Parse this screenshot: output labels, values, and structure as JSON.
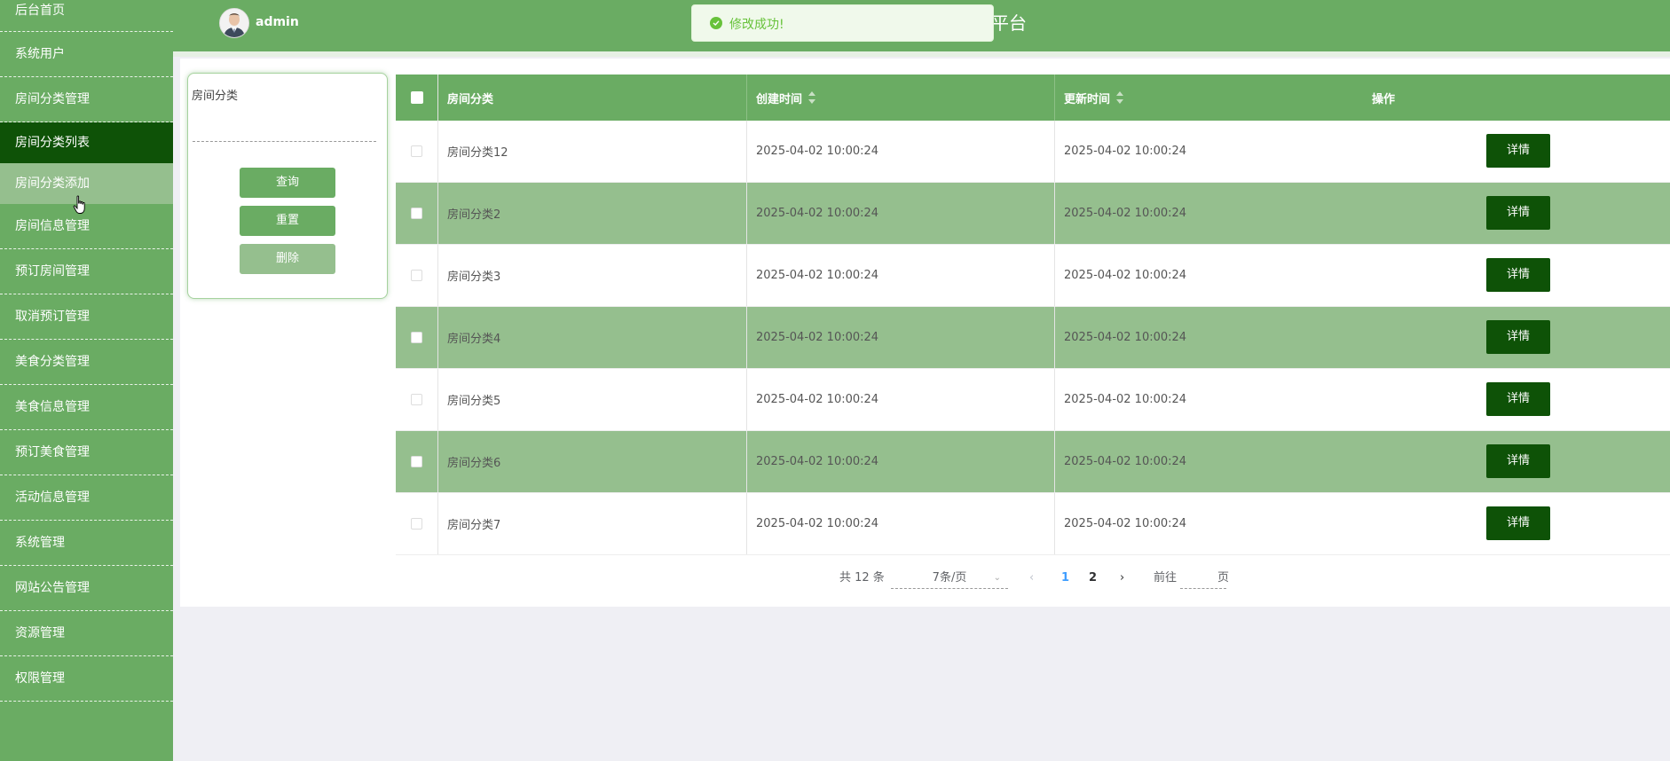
{
  "sidebar": {
    "items": [
      {
        "label": "后台首页",
        "state": "normal"
      },
      {
        "label": "系统用户",
        "state": "normal"
      },
      {
        "label": "房间分类管理",
        "state": "normal"
      },
      {
        "label": "房间分类列表",
        "state": "active"
      },
      {
        "label": "房间分类添加",
        "state": "hover"
      },
      {
        "label": "房间信息管理",
        "state": "normal"
      },
      {
        "label": "预订房间管理",
        "state": "normal"
      },
      {
        "label": "取消预订管理",
        "state": "normal"
      },
      {
        "label": "美食分类管理",
        "state": "normal"
      },
      {
        "label": "美食信息管理",
        "state": "normal"
      },
      {
        "label": "预订美食管理",
        "state": "normal"
      },
      {
        "label": "活动信息管理",
        "state": "normal"
      },
      {
        "label": "系统管理",
        "state": "normal"
      },
      {
        "label": "网站公告管理",
        "state": "normal"
      },
      {
        "label": "资源管理",
        "state": "normal"
      },
      {
        "label": "权限管理",
        "state": "normal"
      }
    ]
  },
  "header": {
    "username": "admin",
    "title_fragment": "平台",
    "toast": "修改成功!"
  },
  "search": {
    "label": "房间分类",
    "value": "",
    "query_button": "查询",
    "reset_button": "重置",
    "delete_button": "删除"
  },
  "table": {
    "headers": {
      "name": "房间分类",
      "created": "创建时间",
      "updated": "更新时间",
      "actions": "操作"
    },
    "detail_label": "详情",
    "rows": [
      {
        "name": "房间分类12",
        "created": "2025-04-02 10:00:24",
        "updated": "2025-04-02 10:00:24"
      },
      {
        "name": "房间分类2",
        "created": "2025-04-02 10:00:24",
        "updated": "2025-04-02 10:00:24"
      },
      {
        "name": "房间分类3",
        "created": "2025-04-02 10:00:24",
        "updated": "2025-04-02 10:00:24"
      },
      {
        "name": "房间分类4",
        "created": "2025-04-02 10:00:24",
        "updated": "2025-04-02 10:00:24"
      },
      {
        "name": "房间分类5",
        "created": "2025-04-02 10:00:24",
        "updated": "2025-04-02 10:00:24"
      },
      {
        "name": "房间分类6",
        "created": "2025-04-02 10:00:24",
        "updated": "2025-04-02 10:00:24"
      },
      {
        "name": "房间分类7",
        "created": "2025-04-02 10:00:24",
        "updated": "2025-04-02 10:00:24"
      }
    ]
  },
  "pagination": {
    "total": "共 12 条",
    "page_size": "7条/页",
    "pages": [
      "1",
      "2"
    ],
    "current_page": "1",
    "goto_label": "前往",
    "goto_value": "",
    "page_unit": "页"
  },
  "colors": {
    "primary": "#6aac63",
    "active": "#0e5207",
    "stripe": "#95bf8e",
    "success": "#67c23a",
    "link": "#409eff"
  },
  "icons": {
    "toast": "success-check-icon",
    "cursor": "hand-pointer-icon",
    "sort": "sort-caret-icon",
    "prev": "chevron-left-icon",
    "next": "chevron-right-icon",
    "dropdown": "chevron-down-icon"
  }
}
